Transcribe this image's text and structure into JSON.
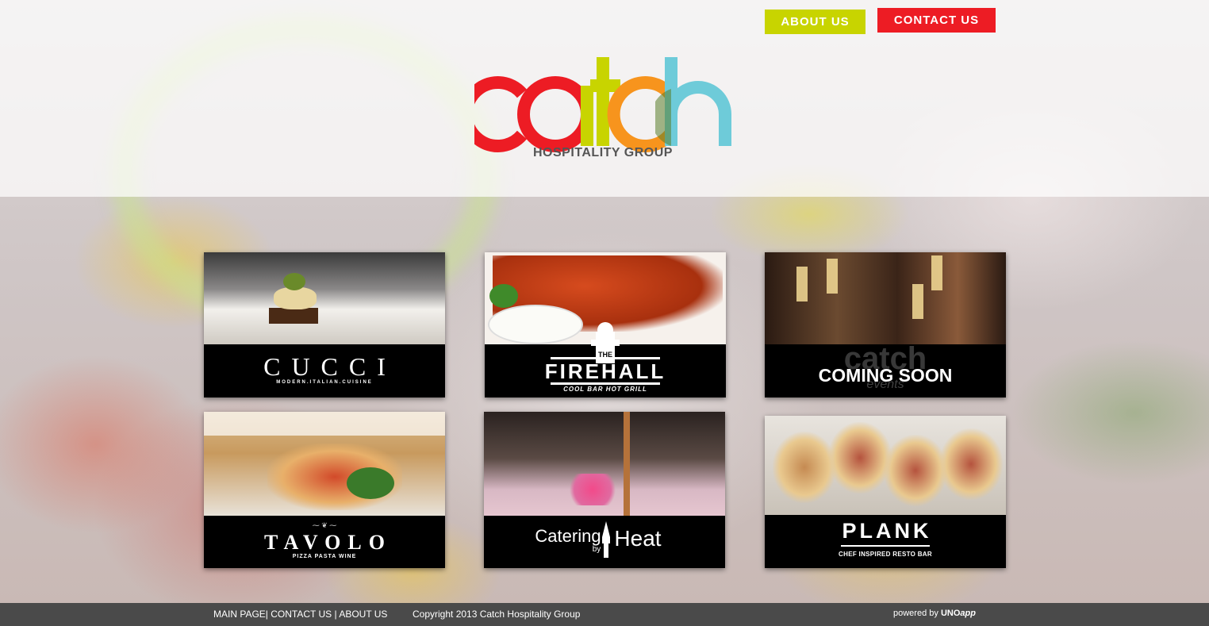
{
  "nav": {
    "about_label": "ABOUT US",
    "contact_label": "CONTACT US"
  },
  "logo": {
    "word": "catch",
    "subtitle": "HOSPITALITY GROUP"
  },
  "cards": [
    {
      "name": "CUCCI",
      "tagline": "MODERN.ITALIAN.CUISINE"
    },
    {
      "name": "FIREHALL",
      "prefix": "THE",
      "tagline": "COOL BAR HOT GRILL"
    },
    {
      "name": "COMING SOON",
      "watermark_word": "catch",
      "watermark_sub": "events"
    },
    {
      "name": "TAVOLO",
      "tagline": "PIZZA  PASTA  WINE"
    },
    {
      "name_part1": "Catering",
      "name_by": "by",
      "name_part2": "Heat"
    },
    {
      "name": "PLANK",
      "tagline": "CHEF INSPIRED RESTO BAR"
    }
  ],
  "footer": {
    "link_main": "MAIN PAGE",
    "link_contact": "CONTACT US",
    "link_about": "ABOUT US",
    "sep1": "|",
    "sep2": "|",
    "copyright": "Copyright 2013 Catch Hospitality Group",
    "powered_prefix": "powered by",
    "powered_brand": "UNO",
    "powered_brand_italic": "app"
  },
  "colors": {
    "about_button": "#c8d400",
    "contact_button": "#ed1c24",
    "logo_red": "#ed1c24",
    "logo_green": "#c8d400",
    "logo_orange": "#f7941d",
    "logo_blue": "#6ecbd9",
    "footer_bg": "#4a4a4a"
  }
}
